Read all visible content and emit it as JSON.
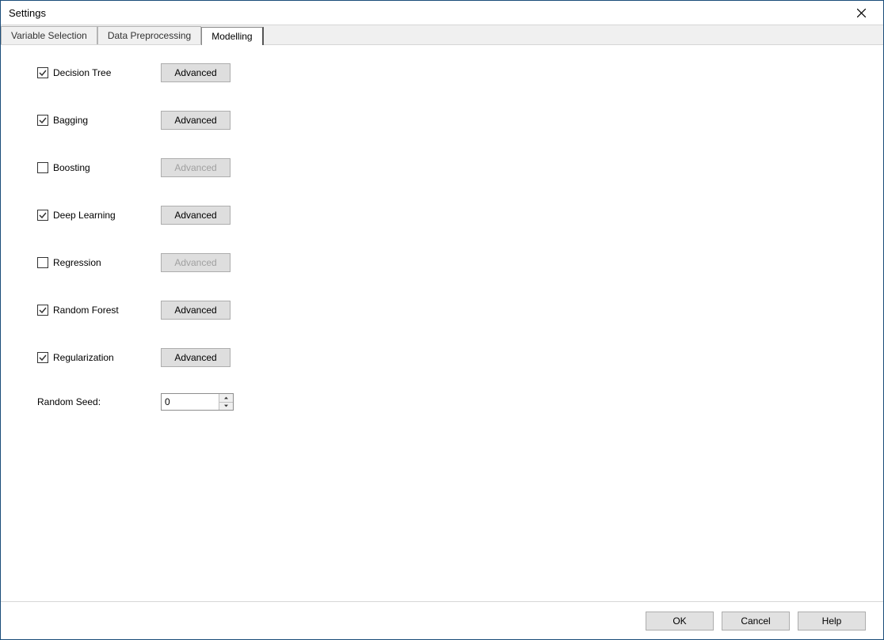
{
  "window": {
    "title": "Settings"
  },
  "tabs": [
    {
      "label": "Variable Selection",
      "active": false
    },
    {
      "label": "Data Preprocessing",
      "active": false
    },
    {
      "label": "Modelling",
      "active": true
    }
  ],
  "models": [
    {
      "label": "Decision Tree",
      "checked": true
    },
    {
      "label": "Bagging",
      "checked": true
    },
    {
      "label": "Boosting",
      "checked": false
    },
    {
      "label": "Deep Learning",
      "checked": true
    },
    {
      "label": "Regression",
      "checked": false
    },
    {
      "label": "Random Forest",
      "checked": true
    },
    {
      "label": "Regularization",
      "checked": true
    }
  ],
  "advanced_label": "Advanced",
  "seed": {
    "label": "Random Seed:",
    "value": "0"
  },
  "footer": {
    "ok": "OK",
    "cancel": "Cancel",
    "help": "Help"
  }
}
